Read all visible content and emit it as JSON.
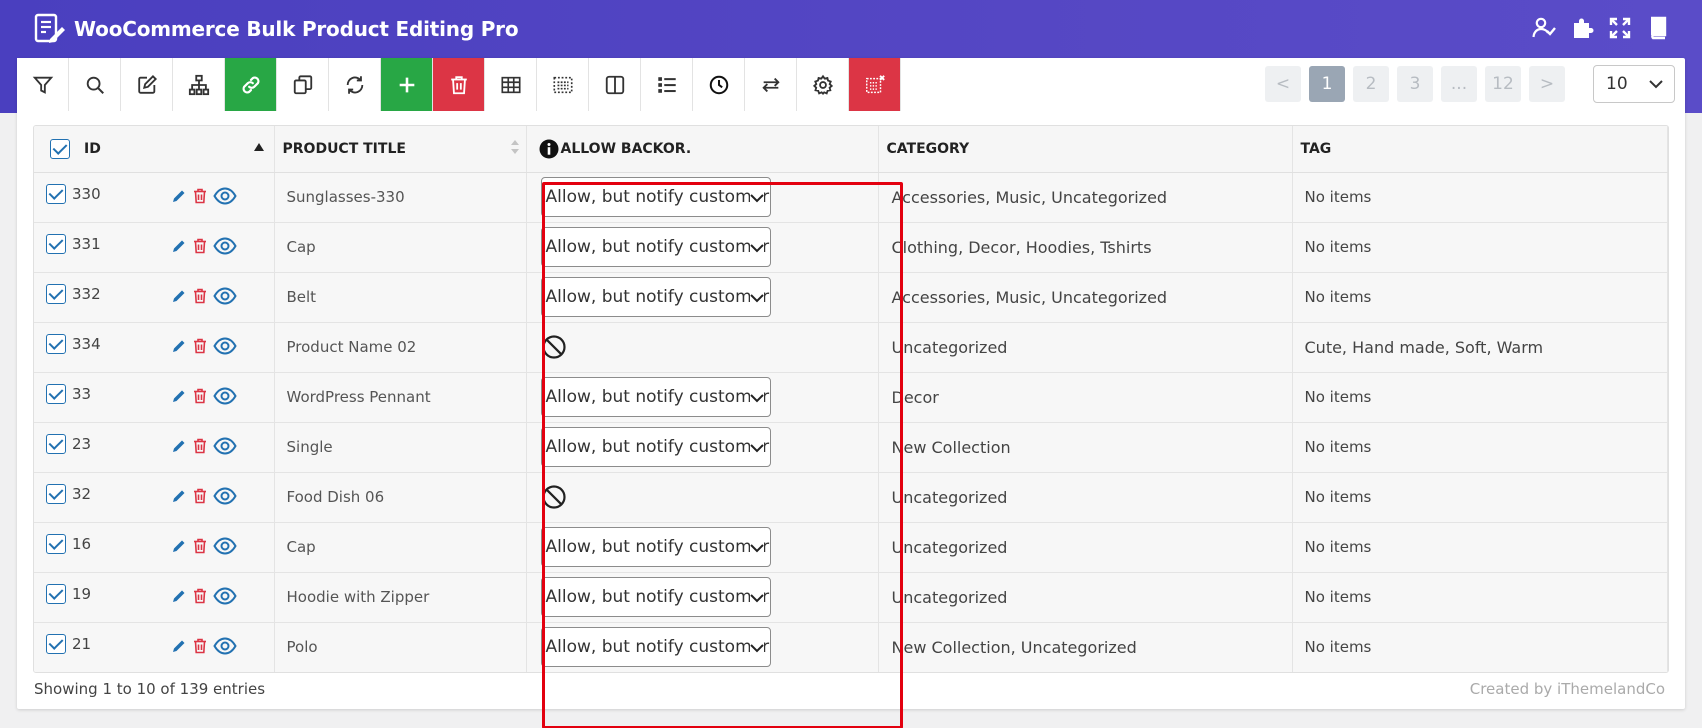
{
  "app": {
    "title": "WooCommerce Bulk Product Editing Pro",
    "header_icons": [
      "user-check-icon",
      "puzzle-icon",
      "fullscreen-icon",
      "book-icon"
    ]
  },
  "toolbar": {
    "buttons": [
      {
        "name": "filter-icon",
        "style": "default"
      },
      {
        "name": "search-icon",
        "style": "default"
      },
      {
        "name": "edit-icon",
        "style": "default"
      },
      {
        "name": "sitemap-icon",
        "style": "default"
      },
      {
        "name": "link-icon",
        "style": "green"
      },
      {
        "name": "duplicate-icon",
        "style": "default"
      },
      {
        "name": "refresh-icon",
        "style": "default"
      },
      {
        "name": "plus-icon",
        "style": "green"
      },
      {
        "name": "trash-icon",
        "style": "red"
      },
      {
        "name": "table-icon",
        "style": "default"
      },
      {
        "name": "select-grid-icon",
        "style": "default"
      },
      {
        "name": "columns-icon",
        "style": "default"
      },
      {
        "name": "list-icon",
        "style": "default"
      },
      {
        "name": "history-icon",
        "style": "default"
      },
      {
        "name": "swap-icon",
        "style": "default"
      },
      {
        "name": "gear-icon",
        "style": "default"
      },
      {
        "name": "clear-grid-icon",
        "style": "red"
      }
    ]
  },
  "pagination": {
    "prev": "<",
    "pages": [
      "1",
      "2",
      "3",
      "...",
      "12"
    ],
    "current": "1",
    "next": ">",
    "per_page": "10"
  },
  "table": {
    "headers": {
      "id": "ID",
      "title": "PRODUCT TITLE",
      "backorders": "ALLOW BACKOR.",
      "category": "CATEGORY",
      "tag": "TAG"
    },
    "rows": [
      {
        "id": "330",
        "title": "Sunglasses-330",
        "backorders": "Allow, but notify customer",
        "category": "Accessories, Music, Uncategorized",
        "tag": "No items"
      },
      {
        "id": "331",
        "title": "Cap",
        "backorders": "Allow, but notify customer",
        "category": "Clothing, Decor, Hoodies, Tshirts",
        "tag": "No items"
      },
      {
        "id": "332",
        "title": "Belt",
        "backorders": "Allow, but notify customer",
        "category": "Accessories, Music, Uncategorized",
        "tag": "No items"
      },
      {
        "id": "334",
        "title": "Product Name 02",
        "backorders": null,
        "category": "Uncategorized",
        "tag": "Cute, Hand made, Soft, Warm"
      },
      {
        "id": "33",
        "title": "WordPress Pennant",
        "backorders": "Allow, but notify customer",
        "category": "Decor",
        "tag": "No items"
      },
      {
        "id": "23",
        "title": "Single",
        "backorders": "Allow, but notify customer",
        "category": "New Collection",
        "tag": "No items"
      },
      {
        "id": "32",
        "title": "Food Dish 06",
        "backorders": null,
        "category": "Uncategorized",
        "tag": "No items"
      },
      {
        "id": "16",
        "title": "Cap",
        "backorders": "Allow, but notify customer",
        "category": "Uncategorized",
        "tag": "No items"
      },
      {
        "id": "19",
        "title": "Hoodie with Zipper",
        "backorders": "Allow, but notify customer",
        "category": "Uncategorized",
        "tag": "No items"
      },
      {
        "id": "21",
        "title": "Polo",
        "backorders": "Allow, but notify customer",
        "category": "New Collection, Uncategorized",
        "tag": "No items"
      }
    ]
  },
  "footer": {
    "showing": "Showing 1 to 10 of 139 entries",
    "credit": "Created by iThemelandCo"
  },
  "colors": {
    "header_bg": "#4a3fbf",
    "green": "#28a745",
    "red": "#dc3545",
    "highlight": "#e3000f",
    "checkbox": "#2271b1",
    "edit_icon": "#2271b1",
    "delete_icon": "#dc3545"
  }
}
